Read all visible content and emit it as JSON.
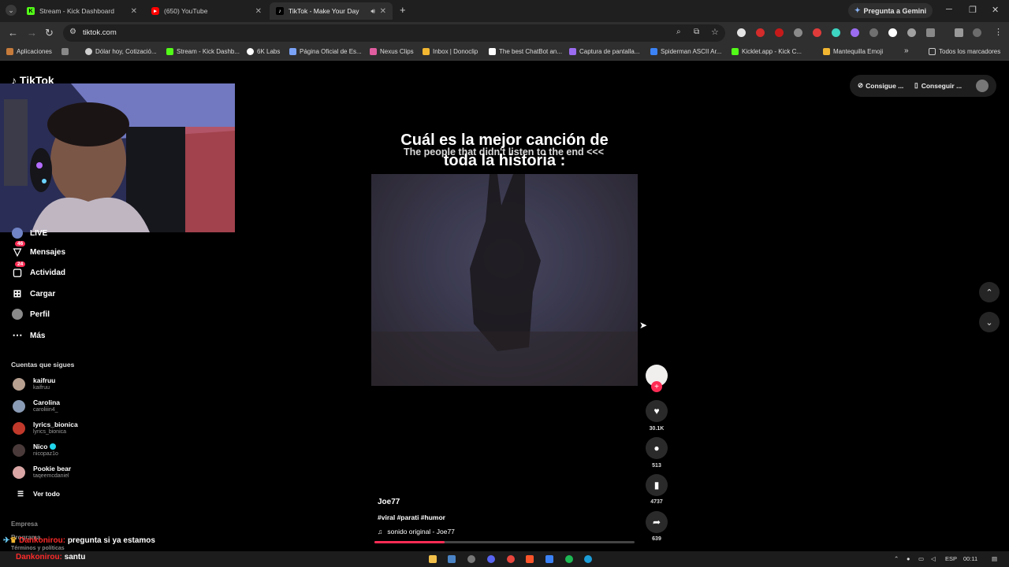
{
  "browser": {
    "tabs": [
      {
        "title": "Stream - Kick Dashboard",
        "favicon": "kick-icon",
        "color": "#53fc18",
        "active": false
      },
      {
        "title": "(650) YouTube",
        "favicon": "youtube-icon",
        "color": "#ff0000",
        "active": false
      },
      {
        "title": "TikTok - Make Your Day",
        "favicon": "tiktok-icon",
        "color": "#ffffff",
        "active": true
      }
    ],
    "new_tab": "+",
    "gemini_label": "Pregunta a Gemini",
    "url": "tiktok.com",
    "bookmarks": [
      "Aplicaciones",
      "Dólar hoy, Cotizació...",
      "Stream - Kick Dashb...",
      "6K Labs",
      "Página Oficial de Es...",
      "Nexus Clips",
      "Inbox | Donoclip",
      "The best ChatBot an...",
      "Captura de pantalla...",
      "Spiderman ASCII Ar...",
      "Kicklet.app - Kick C...",
      "Mantequilla Emoji"
    ],
    "bookmarks_overflow": "»",
    "all_bookmarks": "Todos los marcadores"
  },
  "tiktok": {
    "logo": "TikTok",
    "header_buttons": {
      "coins": "Consigue ...",
      "app": "Conseguir ..."
    },
    "nav": {
      "live": "LIVE",
      "messages": "Mensajes",
      "messages_badge": "46",
      "activity": "Actividad",
      "activity_badge": "24",
      "upload": "Cargar",
      "profile": "Perfil",
      "more": "Más"
    },
    "following_title": "Cuentas que sigues",
    "following": [
      {
        "name": "kaifruu",
        "username": "kaifruu",
        "color": "#b7a090",
        "verified": false
      },
      {
        "name": "Carolina",
        "username": "caroliiin4_",
        "color": "#8a9bb5",
        "verified": false
      },
      {
        "name": "lyrics_bionica",
        "username": "lyrics_bionica",
        "color": "#c0392b",
        "verified": false
      },
      {
        "name": "Nico",
        "username": "nicopaz1o",
        "color": "#4a3a3a",
        "verified": true
      },
      {
        "name": "Pookie bear",
        "username": "taqeemcdaniel",
        "color": "#d9a5a5",
        "verified": false
      }
    ],
    "see_all": "Ver todo",
    "footer": [
      "Empresa",
      "Programa",
      "Términos y políticas"
    ],
    "video": {
      "caption_large": "Cuál es la mejor canción de toda la historia :",
      "caption_small": "The people that didn't listen to the end <<<",
      "author": "Joe77",
      "hashtags": "#viral #parati #humor",
      "sound": "sonido original - Joe77",
      "progress": 0.27
    },
    "actions": {
      "likes": "30.1K",
      "comments": "513",
      "saves": "4737",
      "shares": "639"
    }
  },
  "stream_chat": [
    {
      "user": "Dankonirou:",
      "message": "pregunta si ya estamos"
    },
    {
      "user": "Dankonirou:",
      "message": "santu"
    }
  ],
  "taskbar": {
    "lang": "ESP",
    "time": "00:11"
  }
}
